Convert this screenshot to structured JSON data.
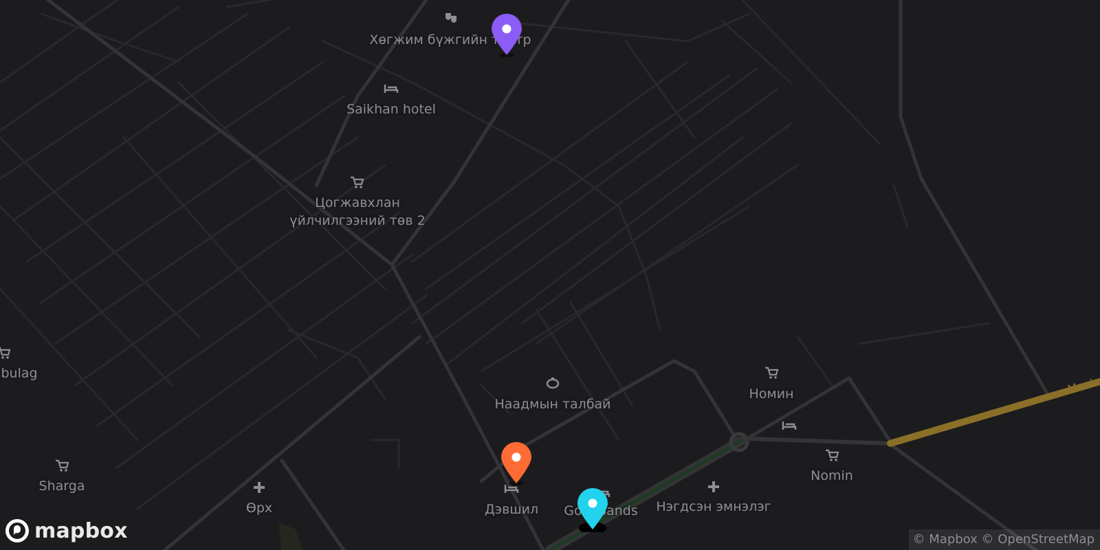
{
  "map": {
    "background": "#1c1c1e",
    "road_color": "#2e2e31",
    "highway_color": "#8a6f28",
    "label_color": "#8e8e93",
    "highway_label": "Manl"
  },
  "labels": [
    {
      "id": "theater",
      "text": "Хөгжим бүжгийн театр"
    },
    {
      "id": "saikhan",
      "text": "Saikhan hotel"
    },
    {
      "id": "tsogjavkhlan",
      "text": "Цогжавхлан\nүйлчилгээний төв 2"
    },
    {
      "id": "naadam",
      "text": "Наадмын талбай"
    },
    {
      "id": "nomin1",
      "text": "Номин"
    },
    {
      "id": "nomin2",
      "text": "Nomin"
    },
    {
      "id": "bulag",
      "text": "nbulag"
    },
    {
      "id": "sharga",
      "text": "Sharga"
    },
    {
      "id": "orkh",
      "text": "Өрх"
    },
    {
      "id": "devshil",
      "text": "Дэвшил"
    },
    {
      "id": "gobisands",
      "text": "Gobi Sands"
    },
    {
      "id": "hospital",
      "text": "Нэгдсэн эмнэлэг"
    }
  ],
  "poi_icons": [
    {
      "id": "theater-icon",
      "icon": "theater-masks"
    },
    {
      "id": "saikhan-icon",
      "icon": "bed"
    },
    {
      "id": "tsog-icon",
      "icon": "shopping-cart"
    },
    {
      "id": "naadam-icon",
      "icon": "stadium"
    },
    {
      "id": "nomin1-icon",
      "icon": "shopping-cart"
    },
    {
      "id": "nomin-hotel-icon",
      "icon": "bed"
    },
    {
      "id": "nomin2-icon",
      "icon": "shopping-cart"
    },
    {
      "id": "bulag-icon",
      "icon": "shopping-cart"
    },
    {
      "id": "sharga-icon",
      "icon": "shopping-cart"
    },
    {
      "id": "orkh-icon",
      "icon": "medical-cross"
    },
    {
      "id": "devshil-icon",
      "icon": "bed"
    },
    {
      "id": "gobi-icon",
      "icon": "bed"
    },
    {
      "id": "hospital-icon",
      "icon": "medical-cross"
    }
  ],
  "markers": [
    {
      "id": "purple",
      "color": "#8b5cf6"
    },
    {
      "id": "orange",
      "color": "#ff6b35"
    },
    {
      "id": "cyan",
      "color": "#22d3ee"
    }
  ],
  "attribution": "© Mapbox © OpenStreetMap",
  "logo_text": "mapbox"
}
